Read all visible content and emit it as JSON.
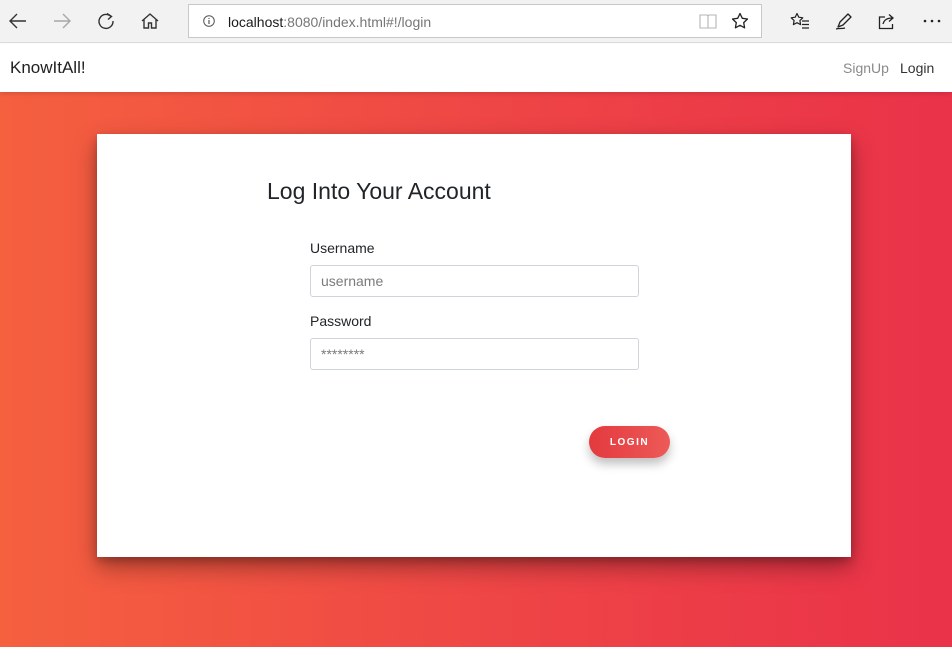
{
  "browser": {
    "url_host": "localhost",
    "url_rest": ":8080/index.html#!/login"
  },
  "navbar": {
    "brand": "KnowItAll!",
    "links": [
      {
        "label": "SignUp"
      },
      {
        "label": "Login"
      }
    ]
  },
  "form": {
    "title": "Log Into Your Account",
    "username": {
      "label": "Username",
      "value": "",
      "placeholder": "username"
    },
    "password": {
      "label": "Password",
      "value": "",
      "placeholder": "********"
    },
    "submit_label": "LOGIN"
  },
  "colors": {
    "gradient_start": "#f5603f",
    "gradient_end": "#ea3249",
    "button": "#e33a3e"
  },
  "icons": {
    "back": "arrow-left-icon",
    "forward": "arrow-right-icon",
    "refresh": "refresh-icon",
    "home": "home-icon",
    "info": "info-icon",
    "reading_view": "book-icon",
    "favorite": "star-icon",
    "favorites_list": "favorites-icon",
    "notes": "pen-icon",
    "share": "share-icon",
    "more": "more-icon"
  }
}
